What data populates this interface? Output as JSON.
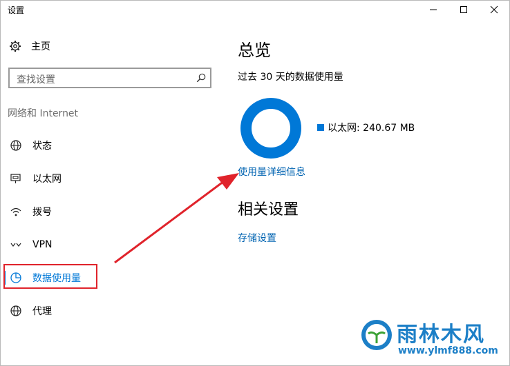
{
  "window": {
    "title": "设置"
  },
  "sidebar": {
    "home_label": "主页",
    "search_placeholder": "查找设置",
    "section_label": "网络和 Internet",
    "items": [
      {
        "label": "状态",
        "icon": "globe-status-icon"
      },
      {
        "label": "以太网",
        "icon": "ethernet-icon"
      },
      {
        "label": "拨号",
        "icon": "dialup-icon"
      },
      {
        "label": "VPN",
        "icon": "vpn-icon"
      },
      {
        "label": "数据使用量",
        "icon": "pie-chart-icon",
        "active": true
      },
      {
        "label": "代理",
        "icon": "globe-icon"
      }
    ]
  },
  "main": {
    "heading": "总览",
    "subtitle": "过去 30 天的数据使用量",
    "legend_label": "以太网: 240.67 MB",
    "details_link": "使用量详细信息",
    "related_heading": "相关设置",
    "storage_link": "存储设置"
  },
  "colors": {
    "accent": "#0078d7",
    "link": "#0063b1",
    "annotation": "#e0232b"
  },
  "watermark": {
    "brand": "雨林木风",
    "url": "www.ylmf888.com"
  }
}
